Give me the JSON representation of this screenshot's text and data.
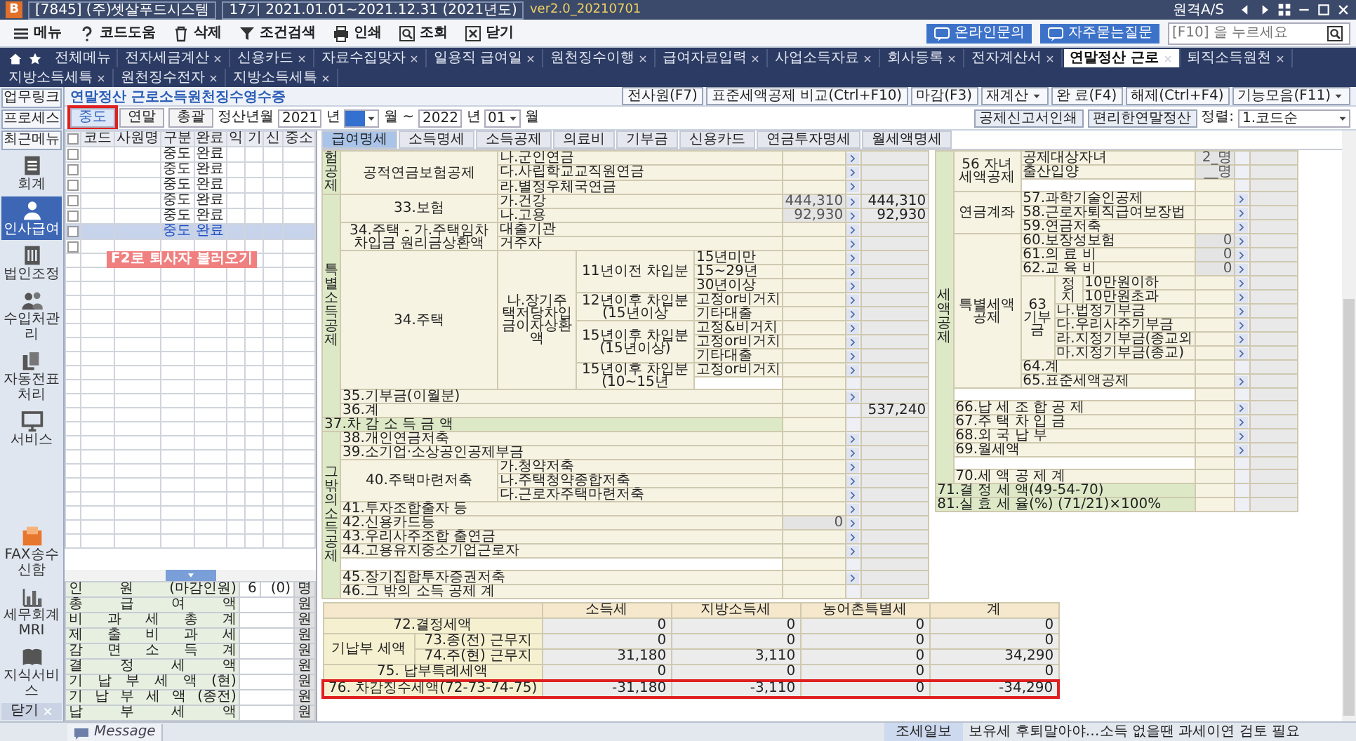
{
  "titlebar": {
    "logo": "B",
    "company": "[7845] (주)셋살푸드시스템",
    "period": "17기 2021.01.01~2021.12.31 (2021년도)",
    "version": "ver2.0_20210701",
    "remote": "원격A/S"
  },
  "toolbar": {
    "buttons": [
      {
        "label": "메뉴",
        "kind": "menu"
      },
      {
        "label": "코드도움",
        "kind": "help"
      },
      {
        "label": "삭제",
        "kind": "trash"
      },
      {
        "label": "조건검색",
        "kind": "filter"
      },
      {
        "label": "인쇄",
        "kind": "print"
      },
      {
        "label": "조회",
        "kind": "search"
      },
      {
        "label": "닫기",
        "kind": "close"
      }
    ],
    "links": [
      "온라인문의",
      "자주묻는질문"
    ],
    "search": {
      "placeholder": "[F10] 을 누르세요"
    }
  },
  "tabs": [
    {
      "label": "전체메뉴",
      "selected": false,
      "closable": false
    },
    {
      "label": "전자세금계산",
      "selected": false,
      "closable": true
    },
    {
      "label": "신용카드",
      "selected": false,
      "closable": true
    },
    {
      "label": "자료수집맞자",
      "selected": false,
      "closable": true
    },
    {
      "label": "일용직 급여일",
      "selected": false,
      "closable": true
    },
    {
      "label": "원천징수이행",
      "selected": false,
      "closable": true
    },
    {
      "label": "급여자료입력",
      "selected": false,
      "closable": true
    },
    {
      "label": "사업소득자료",
      "selected": false,
      "closable": true
    },
    {
      "label": "회사등록",
      "selected": false,
      "closable": true
    },
    {
      "label": "전자계산서",
      "selected": false,
      "closable": true
    },
    {
      "label": "연말정산 근로",
      "selected": true,
      "closable": true
    },
    {
      "label": "퇴직소득원천",
      "selected": false,
      "closable": true
    },
    {
      "label": "지방소득세특",
      "selected": false,
      "closable": true
    },
    {
      "label": "원천징수전자",
      "selected": false,
      "closable": true
    },
    {
      "label": "지방소득세특",
      "selected": false,
      "closable": true
    }
  ],
  "sidebar": {
    "top": [
      "업무링크",
      "프로세스",
      "최근메뉴"
    ],
    "items": [
      {
        "label": "회계",
        "kind": "ledger",
        "selected": false
      },
      {
        "label": "인사급여",
        "kind": "person",
        "selected": true
      },
      {
        "label": "법인조정",
        "kind": "building",
        "selected": false
      },
      {
        "label": "수입처관리",
        "kind": "people",
        "selected": false
      },
      {
        "label": "자동전표처리",
        "kind": "docs",
        "selected": false
      },
      {
        "label": "서비스",
        "kind": "monitor",
        "selected": false
      }
    ],
    "bottom": [
      {
        "label": "FAX송수신함",
        "kind": "fax"
      },
      {
        "label": "세무회계MRI",
        "kind": "chart"
      },
      {
        "label": "지식서비스",
        "kind": "book"
      }
    ],
    "close": "닫기"
  },
  "page": {
    "title": "연말정산 근로소득원천징수영수증",
    "buttons": [
      {
        "label": "전사원(F7)",
        "dropdown": false
      },
      {
        "label": "표준세액공제 비교(Ctrl+F10)",
        "dropdown": false
      },
      {
        "label": "마감(F3)",
        "dropdown": false
      },
      {
        "label": "재계산",
        "dropdown": true
      },
      {
        "label": "완 료(F4)",
        "dropdown": false
      },
      {
        "label": "해제(Ctrl+F4)",
        "dropdown": false
      },
      {
        "label": "기능모음(F11)",
        "dropdown": true
      }
    ]
  },
  "modes": [
    {
      "label": "중도",
      "selected": true,
      "highlighted": true
    },
    {
      "label": "연말",
      "selected": false,
      "highlighted": false
    },
    {
      "label": "총괄",
      "selected": false,
      "highlighted": false
    }
  ],
  "period": [
    {
      "kind": "label",
      "text": "정산년월"
    },
    {
      "kind": "input",
      "value": "2021"
    },
    {
      "kind": "text",
      "text": "년"
    },
    {
      "kind": "select",
      "focused": true
    },
    {
      "kind": "text",
      "text": "월 ~"
    },
    {
      "kind": "input",
      "value": "2022"
    },
    {
      "kind": "text",
      "text": "년"
    },
    {
      "kind": "select",
      "value": "01",
      "focused": false
    },
    {
      "kind": "text",
      "text": "월"
    }
  ],
  "actions": [
    "공제신고서인쇄",
    "편리한연말정산"
  ],
  "sort": {
    "label": "정렬:",
    "value": "1.코드순"
  },
  "employees": {
    "columns": [
      "코드",
      "사원명",
      "구분",
      "완료",
      "익",
      "기",
      "신",
      "중소"
    ],
    "all_checked": false,
    "blank_row_checked": false,
    "rows": [
      {
        "type": "중도",
        "done": "완료",
        "checked": false,
        "selected": false
      },
      {
        "type": "중도",
        "done": "완료",
        "checked": false,
        "selected": false
      },
      {
        "type": "중도",
        "done": "완료",
        "checked": false,
        "selected": false
      },
      {
        "type": "중도",
        "done": "완료",
        "checked": false,
        "selected": false
      },
      {
        "type": "중도",
        "done": "완료",
        "checked": false,
        "selected": false
      },
      {
        "type": "중도",
        "done": "완료",
        "checked": false,
        "selected": true
      }
    ],
    "hint": "F2로 퇴사자 불러오기"
  },
  "summary": [
    {
      "label": "인 원 (마감인원)",
      "value": "6",
      "extra": "(0)",
      "unit": "명"
    },
    {
      "label": "총 급 여 액",
      "unit": "원"
    },
    {
      "label": "비 과 세 총 계",
      "unit": "원"
    },
    {
      "label": "제 출 비 과 세",
      "unit": "원"
    },
    {
      "label": "감 면 소 득 계",
      "unit": "원"
    },
    {
      "label": "결 정 세 액",
      "unit": "원"
    },
    {
      "label": "기 납 부 세 액 (현)",
      "unit": "원"
    },
    {
      "label": "기 납 부 세 액 (종전)",
      "unit": "원"
    },
    {
      "label": "납 부 세 액",
      "unit": "원"
    }
  ],
  "subtabs": [
    {
      "label": "급여명세",
      "selected": true
    },
    {
      "label": "소득명세",
      "selected": false
    },
    {
      "label": "소득공제",
      "selected": false
    },
    {
      "label": "의료비",
      "selected": false
    },
    {
      "label": "기부금",
      "selected": false
    },
    {
      "label": "신용카드",
      "selected": false
    },
    {
      "label": "연금투자명세",
      "selected": false
    },
    {
      "label": "월세액명세",
      "selected": false
    }
  ],
  "form_left": [
    {
      "label": "험공제",
      "children": [
        {
          "label": "공적연금보험공제",
          "children": [
            {
              "label": "나.군인연금",
              "button": true
            },
            {
              "label": "다.사립학교교직원연금",
              "button": true
            },
            {
              "label": "라.별정우체국연금",
              "button": true
            }
          ]
        }
      ]
    },
    {
      "label": "특별소득공제",
      "children": [
        {
          "label": "33.보험",
          "children": [
            {
              "label": "가.건강",
              "input": "444,310",
              "button": true,
              "value": "444,310"
            },
            {
              "label": "나.고용",
              "input": "92,930",
              "button": true,
              "value": "92,930"
            }
          ]
        },
        {
          "label": "34.주택 - 가.주택임차 차입금 원리금상환액",
          "children": [
            {
              "label": "대출기관",
              "button": true
            },
            {
              "label": "거주자",
              "button": true
            }
          ]
        },
        {
          "label": "34.주택",
          "children": [
            {
              "label": "나.장기주택저당차입금이자상환액",
              "children": [
                {
                  "label": "11년이전 차입분",
                  "children": [
                    {
                      "label": "15년미만",
                      "button": true
                    },
                    {
                      "label": "15~29년",
                      "button": true
                    },
                    {
                      "label": "30년이상",
                      "button": true
                    }
                  ]
                },
                {
                  "label": "12년이후 차입분(15년이상",
                  "children": [
                    {
                      "label": "고정or비거치",
                      "button": true
                    },
                    {
                      "label": "기타대출",
                      "button": true
                    }
                  ]
                },
                {
                  "label": "15년이후 차입분(15년이상)",
                  "children": [
                    {
                      "label": "고정&비거치",
                      "button": true
                    },
                    {
                      "label": "고정or비거치",
                      "button": true
                    },
                    {
                      "label": "기타대출",
                      "button": true
                    }
                  ]
                },
                {
                  "label": "15년이후 차입분(10~15년",
                  "children": [
                    {
                      "label": "고정or비거치",
                      "button": true
                    },
                    {
                      "kind": "blank"
                    }
                  ]
                }
              ]
            }
          ]
        },
        {
          "label": "35.기부금(이월분)",
          "button": true
        },
        {
          "label": "36.계",
          "value": "537,240"
        }
      ]
    },
    {
      "label": "37.차 감 소 득 금 액"
    },
    {
      "label": "그밖의 소득공제",
      "children": [
        {
          "label": "38.개인연금저축",
          "button": true
        },
        {
          "label": "39.소기업·소상공인공제부금",
          "button": true
        },
        {
          "label": "40.주택마련저축",
          "children": [
            {
              "label": "가.청약저축",
              "button": true
            },
            {
              "label": "나.주택청약종합저축",
              "button": true
            },
            {
              "label": "다.근로자주택마련저축",
              "button": true
            }
          ]
        },
        {
          "label": "41.투자조합출자 등",
          "button": true
        },
        {
          "label": "42.신용카드등",
          "input": "0",
          "button": true
        },
        {
          "label": "43.우리사주조합 출연금",
          "button": true
        },
        {
          "label": "44.고용유지중소기업근로자",
          "button": true
        },
        {
          "kind": "blank"
        },
        {
          "label": "45.장기집합투자증권저축",
          "button": true
        },
        {
          "label": "46.그 밖의 소득 공제 계"
        }
      ]
    }
  ],
  "form_right": [
    {
      "label": "세액공제",
      "children": [
        {
          "label": "56 자녀세액공제",
          "children": [
            {
              "label": "공제대상자녀",
              "input": "2_명"
            },
            {
              "label": "출산입양",
              "input": "__명"
            },
            {
              "kind": "blank"
            }
          ]
        },
        {
          "label": "연금계좌",
          "children": [
            {
              "label": "57.과학기술인공제",
              "button": true
            },
            {
              "label": "58.근로자퇴직급여보장법",
              "button": true
            },
            {
              "label": "59.연금저축",
              "button": true
            }
          ]
        },
        {
          "label": "특별세액공제",
          "children": [
            {
              "label": "60.보장성보험",
              "input": "0",
              "button": true
            },
            {
              "label": "61.의 료 비",
              "input": "0",
              "button": true
            },
            {
              "label": "62.교 육 비",
              "input": "0",
              "button": true
            },
            {
              "label": "63 기부금",
              "children": [
                {
                  "label": "정치",
                  "children": [
                    {
                      "label": "10만원이하",
                      "button": true
                    },
                    {
                      "label": "10만원초과",
                      "button": true
                    }
                  ]
                },
                {
                  "label": "나.법정기부금",
                  "button": true
                },
                {
                  "label": "다.우리사주기부금",
                  "button": true
                },
                {
                  "label": "라.지정기부금(종교외",
                  "button": true
                },
                {
                  "label": "마.지정기부금(종교)",
                  "button": true
                }
              ]
            },
            {
              "label": "64.계"
            },
            {
              "label": "65.표준세액공제",
              "button": true
            }
          ]
        },
        {
          "kind": "blank"
        },
        {
          "label": "66.납 세 조 합 공 제",
          "button": true
        },
        {
          "label": "67.주 택 차 입 금",
          "button": true
        },
        {
          "label": "68.외 국 납 부",
          "button": true
        },
        {
          "label": "69.월세액",
          "button": true
        },
        {
          "kind": "blank"
        },
        {
          "label": "70.세 액 공 제 계"
        }
      ]
    },
    {
      "label": "71.결 정 세 액(49-54-70)"
    },
    {
      "label": "81.실 효 세 율(%) (71/21)×100%"
    }
  ],
  "tax_table": {
    "columns": [
      "소득세",
      "지방소득세",
      "농어촌특별세",
      "계"
    ],
    "rows": [
      {
        "label": "72.결정세액",
        "values": [
          "0",
          "0",
          "0",
          "0"
        ],
        "highlighted": false
      },
      {
        "label": "기납부 세액",
        "children": [
          {
            "label": "73.종(전) 근무지",
            "values": [
              "0",
              "0",
              "0",
              "0"
            ]
          },
          {
            "label": "74.주(현) 근무지",
            "values": [
              "31,180",
              "3,110",
              "0",
              "34,290"
            ]
          }
        ]
      },
      {
        "label": "75. 납부특례세액",
        "values": [
          "0",
          "0",
          "0",
          "0"
        ],
        "highlighted": false
      },
      {
        "label": "76. 차감징수세액(72-73-74-75)",
        "values": [
          "-31,180",
          "-3,110",
          "0",
          "-34,290"
        ],
        "highlighted": true
      }
    ]
  },
  "statusbar": {
    "message": "Message",
    "news_source": "조세일보",
    "news": "보유세 후퇴말아야…소득 없을땐 과세이연 검토 필요"
  }
}
